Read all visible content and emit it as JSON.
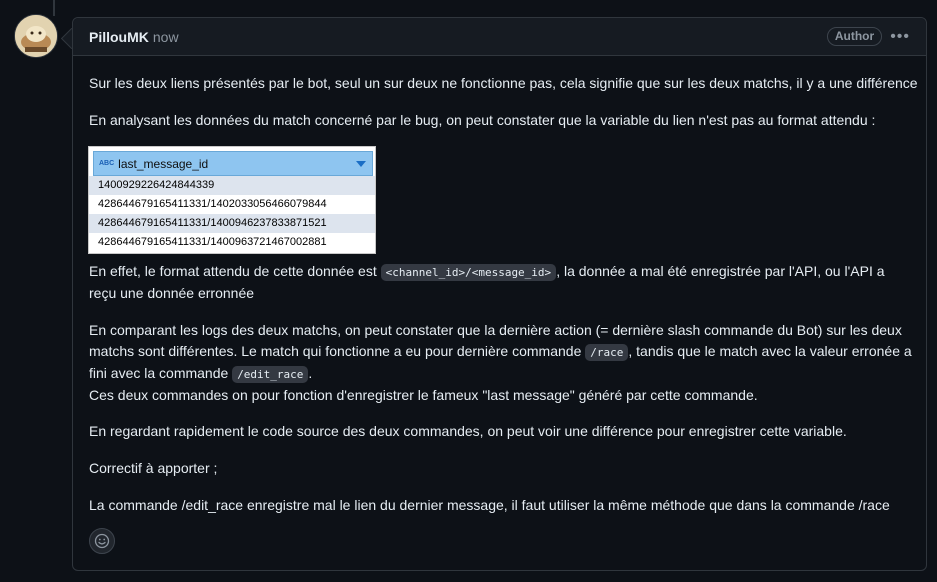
{
  "comment": {
    "author": "PillouMK",
    "timestamp": "now",
    "badge": "Author",
    "menu_icon": "kebab-horizontal-icon"
  },
  "body": {
    "p1": "Sur les deux liens présentés par le bot, seul un sur deux ne fonctionne pas, cela signifie que sur les deux matchs, il y a une différence",
    "p2": "En analysant les données du match concerné par le bug, on peut constater que la variable du lien n'est pas au format attendu :",
    "p3_a": "En effet, le format attendu de cette donnée est ",
    "p3_code": "<channel_id>/<message_id>",
    "p3_b": ", la donnée a mal été enregistrée par l'API, ou l'API a reçu une donnée erronnée",
    "p4_a": "En comparant les logs des deux matchs, on peut constater que la dernière action (= dernière slash commande du Bot) sur les deux matchs sont différentes. Le match qui fonctionne a eu pour dernière commande ",
    "p4_code1": "/race",
    "p4_b": ", tandis que le match avec la valeur erronée a fini avec la commande ",
    "p4_code2": "/edit_race",
    "p4_c": ".",
    "p4_line2": "Ces deux commandes on pour fonction d'enregistrer le fameux \"last message\" généré par cette commande.",
    "p5": "En regardant rapidement le code source des deux commandes, on peut voir une différence pour enregistrer cette variable.",
    "p6": "Correctif à apporter ;",
    "p7": "La commande /edit_race enregistre mal le lien du dernier message, il faut utiliser la même méthode que dans la commande /race"
  },
  "table": {
    "type_icon": "ABC",
    "column": "last_message_id",
    "rows": [
      "1400929226424844339",
      "428644679165411331/1402033056466079844",
      "428644679165411331/1400946237833871521",
      "428644679165411331/1400963721467002881"
    ]
  },
  "reaction": {
    "icon": "smiley-icon"
  }
}
